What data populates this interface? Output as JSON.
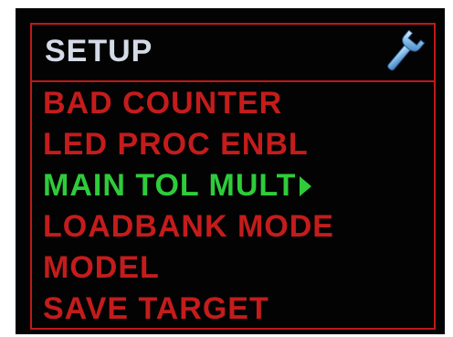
{
  "header": {
    "title": "SETUP",
    "icon": "wrench-icon"
  },
  "colors": {
    "frame": "#c01818",
    "item": "#c41c1c",
    "selected": "#2ecc3a",
    "title": "#d4dbe6",
    "background": "#030303"
  },
  "menu": {
    "items": [
      {
        "label": "BAD COUNTER",
        "selected": false
      },
      {
        "label": "LED PROC ENBL",
        "selected": false
      },
      {
        "label": "MAIN TOL MULT",
        "selected": true
      },
      {
        "label": "LOADBANK MODE",
        "selected": false
      },
      {
        "label": "MODEL",
        "selected": false
      },
      {
        "label": "SAVE TARGET",
        "selected": false
      }
    ]
  }
}
